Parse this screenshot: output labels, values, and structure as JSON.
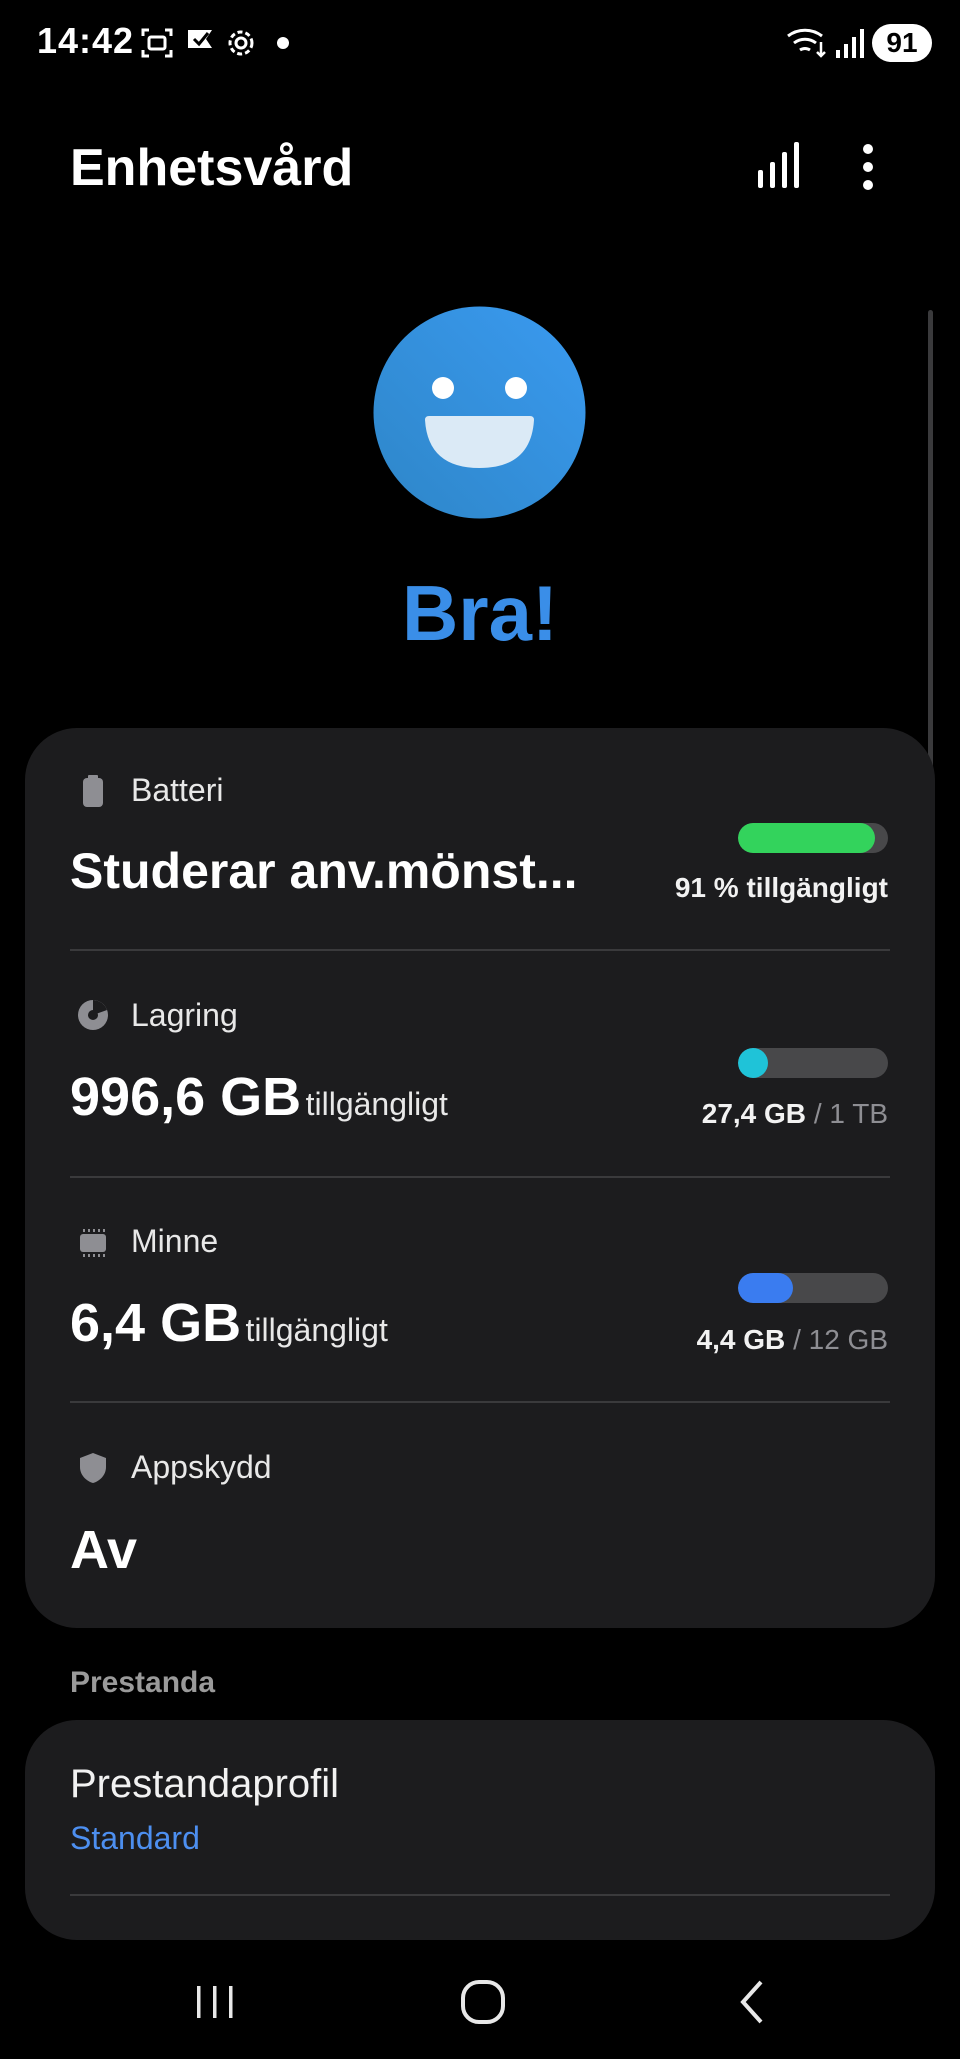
{
  "status_bar": {
    "time": "14:42",
    "battery": "91",
    "icons": [
      "screenshot-icon",
      "check-flag-icon",
      "settings-gear-icon",
      "notification-dot-icon",
      "wifi-icon",
      "signal-icon"
    ]
  },
  "header": {
    "title": "Enhetsvård",
    "icons": [
      "stats-bars-icon",
      "more-vert-icon"
    ]
  },
  "status": {
    "text": "Bra!",
    "face_icon": "happy-face-icon",
    "color": "#3a8ee8"
  },
  "battery": {
    "label": "Batteri",
    "value": "Studerar anv.mönst...",
    "bar_fraction": 0.91,
    "bar_color": "#33d35c",
    "detail": "91 % tillgängligt"
  },
  "storage": {
    "label": "Lagring",
    "value": "996,6 GB",
    "suffix": "tillgängligt",
    "used": "27,4 GB",
    "total": "/ 1 TB",
    "bar_fraction": 0.027,
    "bar_color": "#1fc3d8"
  },
  "memory": {
    "label": "Minne",
    "value": "6,4 GB",
    "suffix": "tillgängligt",
    "used": "4,4 GB",
    "total": "/ 12 GB",
    "bar_fraction": 0.367,
    "bar_color": "#3a7cf0"
  },
  "app_protection": {
    "label": "Appskydd",
    "value": "Av"
  },
  "performance": {
    "section_title": "Prestanda",
    "item_title": "Prestandaprofil",
    "item_value": "Standard"
  },
  "nav_bar": {
    "icons": [
      "recents-icon",
      "home-icon",
      "back-icon"
    ]
  }
}
